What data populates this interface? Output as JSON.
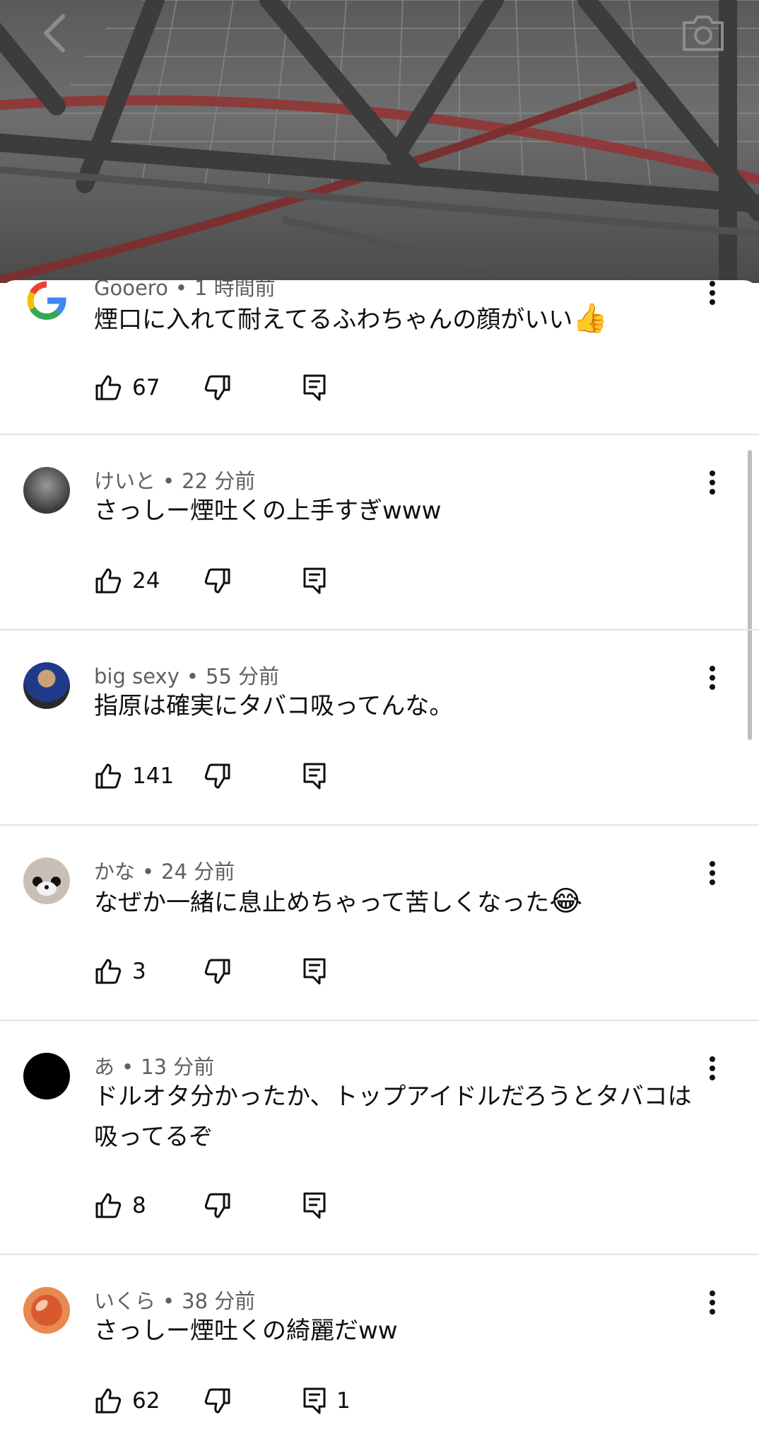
{
  "video": {
    "back_icon": "chevron-left-icon",
    "camera_icon": "camera-icon"
  },
  "comments": [
    {
      "author": "Gooero",
      "time": "1 時間前",
      "text": "煙口に入れて耐えてるふわちゃんの顔がいい",
      "emoji": "👍",
      "likes": "67",
      "replies": ""
    },
    {
      "author": "けいと",
      "time": "22 分前",
      "text": "さっしー煙吐くの上手すぎwww",
      "emoji": "",
      "likes": "24",
      "replies": ""
    },
    {
      "author": "big sexy",
      "time": "55 分前",
      "text": "指原は確実にタバコ吸ってんな。",
      "emoji": "",
      "likes": "141",
      "replies": ""
    },
    {
      "author": "かな",
      "time": "24 分前",
      "text": "なぜか一緒に息止めちゃって苦しくなった",
      "emoji": "😂",
      "likes": "3",
      "replies": ""
    },
    {
      "author": "あ",
      "time": "13 分前",
      "text": "ドルオタ分かったか、トップアイドルだろうとタバコは吸ってるぞ",
      "emoji": "",
      "likes": "8",
      "replies": ""
    },
    {
      "author": "いくら",
      "time": "38 分前",
      "text": "さっしー煙吐くの綺麗だww",
      "emoji": "",
      "likes": "62",
      "replies": "1"
    }
  ],
  "separator": "•"
}
